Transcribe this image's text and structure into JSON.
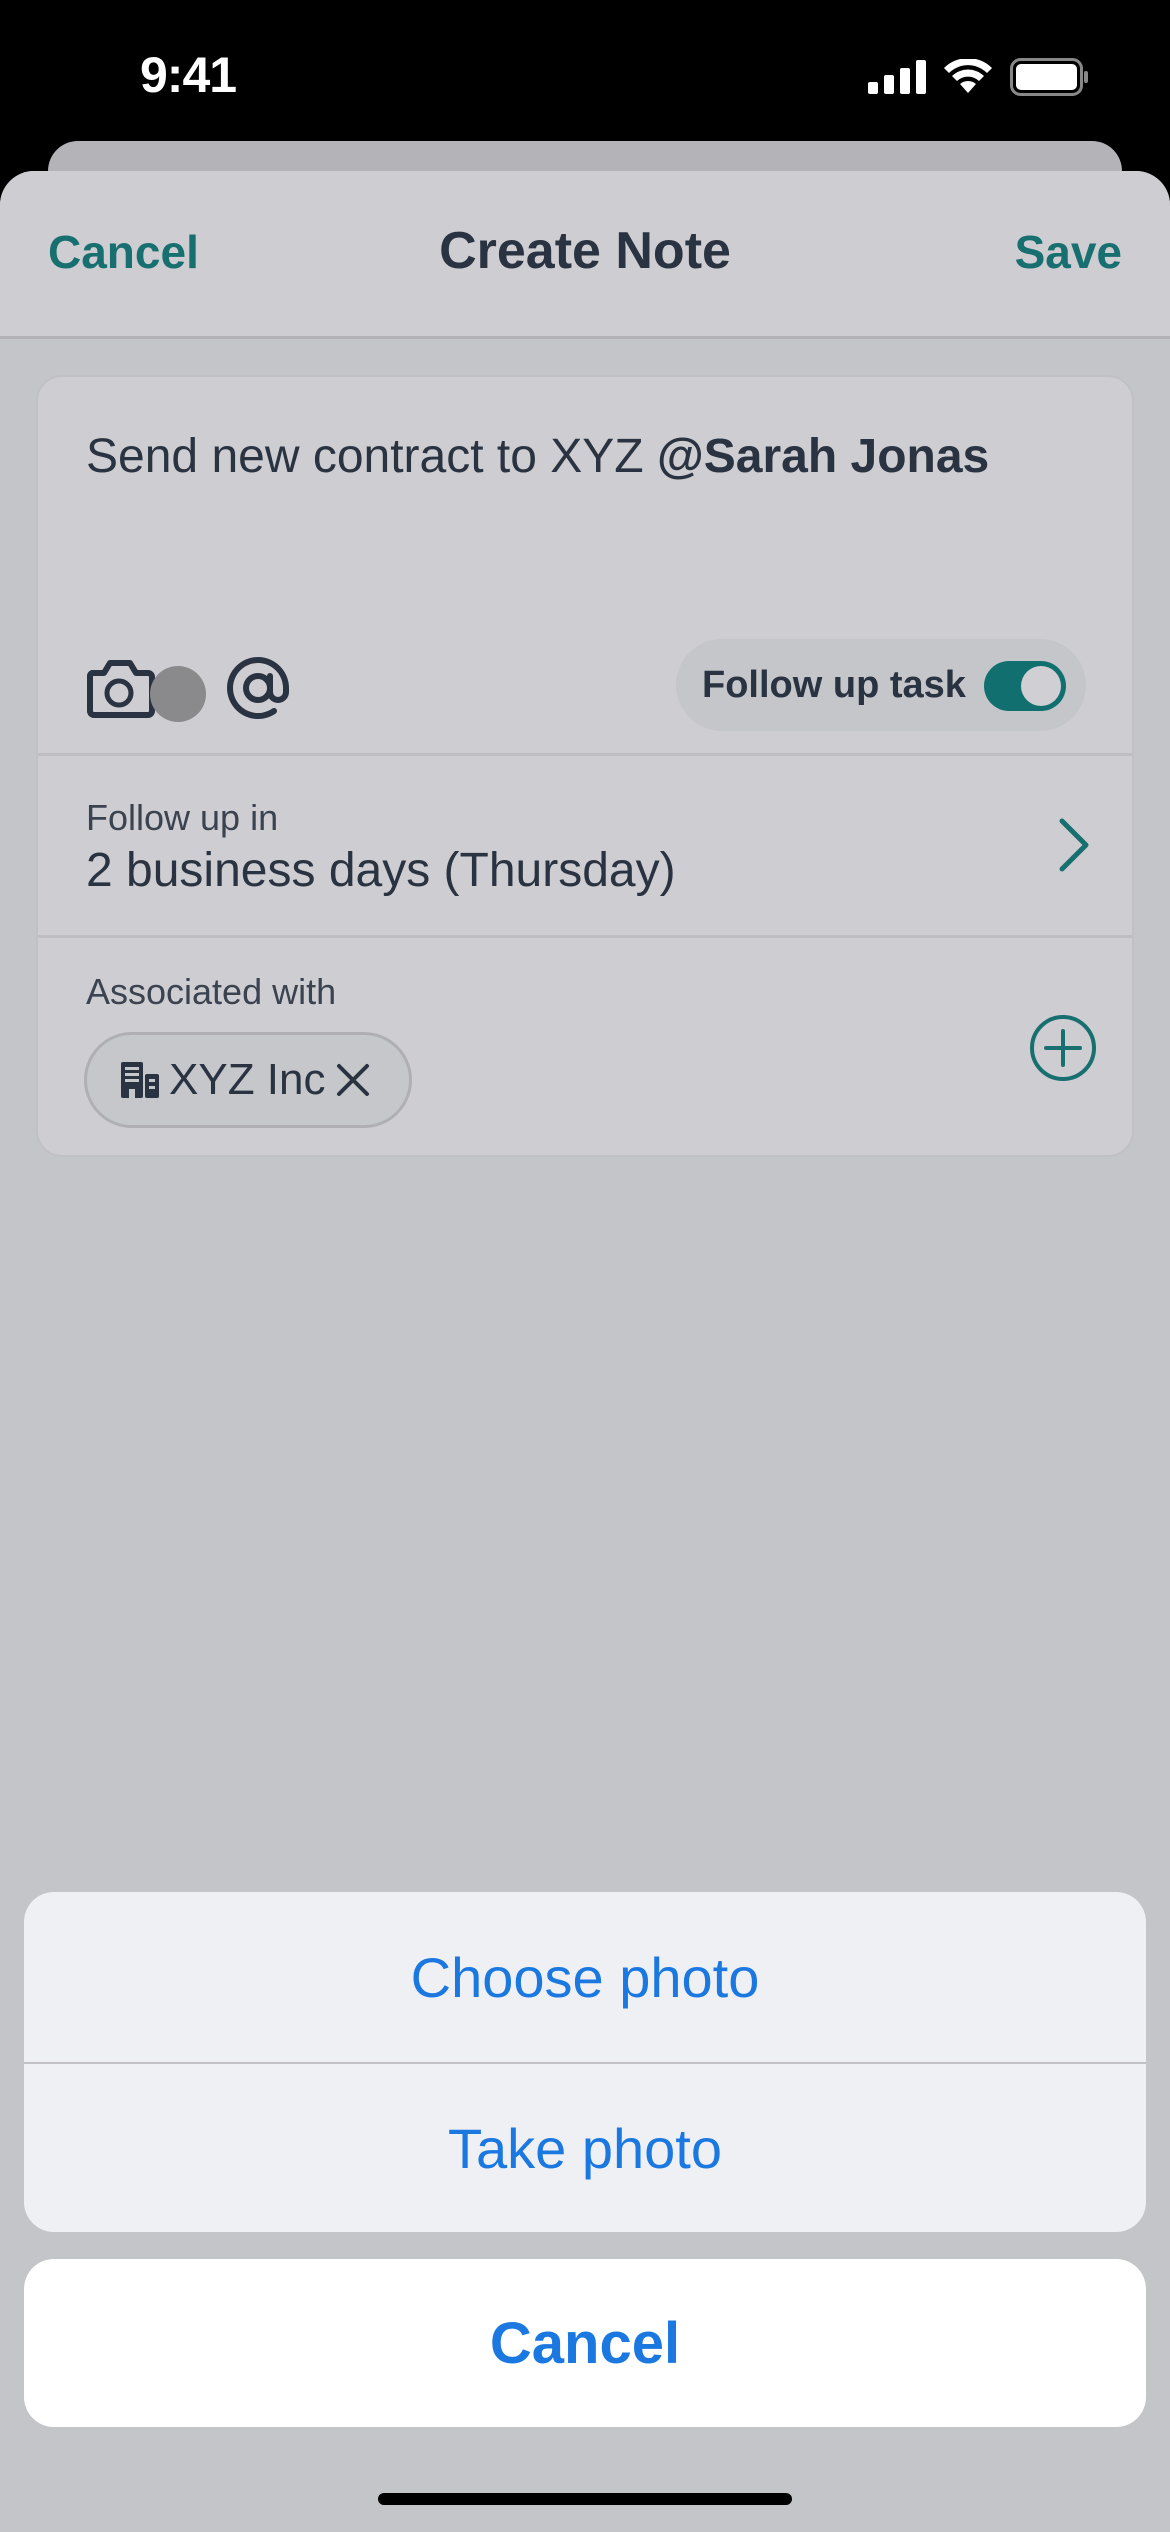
{
  "status_bar": {
    "time": "9:41",
    "icons": [
      "cellular-signal-icon",
      "wifi-icon",
      "battery-icon"
    ]
  },
  "nav": {
    "cancel_label": "Cancel",
    "title": "Create Note",
    "save_label": "Save"
  },
  "note": {
    "text": "Send new contract to XYZ ",
    "mention": "@Sarah Jonas",
    "tools": [
      "camera-icon",
      "at-mention-icon"
    ],
    "follow_up_toggle": {
      "label": "Follow up task",
      "on": true
    }
  },
  "follow_up": {
    "label": "Follow up in",
    "value": "2 business days (Thursday)"
  },
  "associated": {
    "label": "Associated with",
    "chips": [
      {
        "icon": "building-icon",
        "label": "XYZ Inc"
      }
    ]
  },
  "action_sheet": {
    "actions": [
      "Choose photo",
      "Take photo"
    ],
    "cancel_label": "Cancel"
  },
  "colors": {
    "brand_teal": "#176f70",
    "ios_blue": "#1a78e0",
    "text_dark": "#2a3341"
  }
}
